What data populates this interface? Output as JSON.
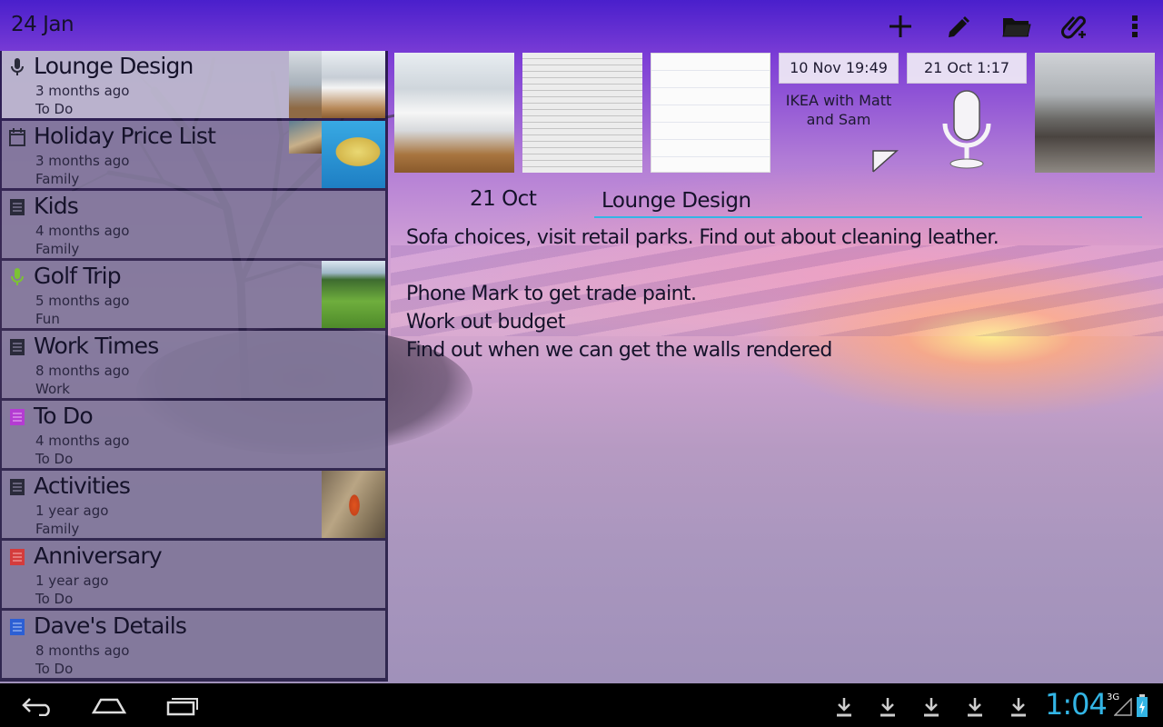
{
  "topbar": {
    "date": "24 Jan",
    "actions": [
      {
        "name": "add-note-button",
        "icon": "plus-icon"
      },
      {
        "name": "edit-button",
        "icon": "pencil-icon"
      },
      {
        "name": "folder-button",
        "icon": "folder-icon"
      },
      {
        "name": "attach-button",
        "icon": "paperclip-add-icon"
      },
      {
        "name": "overflow-menu-button",
        "icon": "more-vert-icon"
      }
    ]
  },
  "notes": [
    {
      "title": "Lounge Design",
      "age": "3 months ago",
      "category": "To Do",
      "type": "audio",
      "icon_color": "#2a2a3a",
      "selected": true
    },
    {
      "title": "Holiday Price List",
      "age": "3 months ago",
      "category": "Family",
      "type": "calendar",
      "icon_color": "#2a2a3a"
    },
    {
      "title": "Kids",
      "age": "4 months ago",
      "category": "Family",
      "type": "text",
      "icon_color": "#2a2a3a"
    },
    {
      "title": "Golf Trip",
      "age": "5 months ago",
      "category": "Fun",
      "type": "audio",
      "icon_color": "#7cc234"
    },
    {
      "title": "Work Times",
      "age": "8 months ago",
      "category": "Work",
      "type": "text",
      "icon_color": "#2a2a3a"
    },
    {
      "title": "To Do",
      "age": "4 months ago",
      "category": "To Do",
      "type": "text",
      "icon_color": "#b43cd2"
    },
    {
      "title": "Activities",
      "age": "1 year ago",
      "category": "Family",
      "type": "text",
      "icon_color": "#2a2a3a"
    },
    {
      "title": "Anniversary",
      "age": "1 year ago",
      "category": "To Do",
      "type": "text",
      "icon_color": "#d43c3c"
    },
    {
      "title": "Dave's Details",
      "age": "8 months ago",
      "category": "To Do",
      "type": "text",
      "icon_color": "#2c5fd4"
    }
  ],
  "attachments": {
    "card1_date": "10 Nov 19:49",
    "card1_caption": "IKEA with Matt and Sam",
    "card2_date": "21 Oct 1:17"
  },
  "note": {
    "date": "21 Oct",
    "title": "Lounge Design",
    "body": [
      "Sofa choices, visit retail parks. Find out about cleaning leather.",
      "",
      "Phone Mark to get trade paint.",
      "Work out budget",
      "Find out when we can get the walls rendered"
    ]
  },
  "statusbar": {
    "time": "1:04",
    "network": "3G",
    "accent": "#33b5e5"
  }
}
